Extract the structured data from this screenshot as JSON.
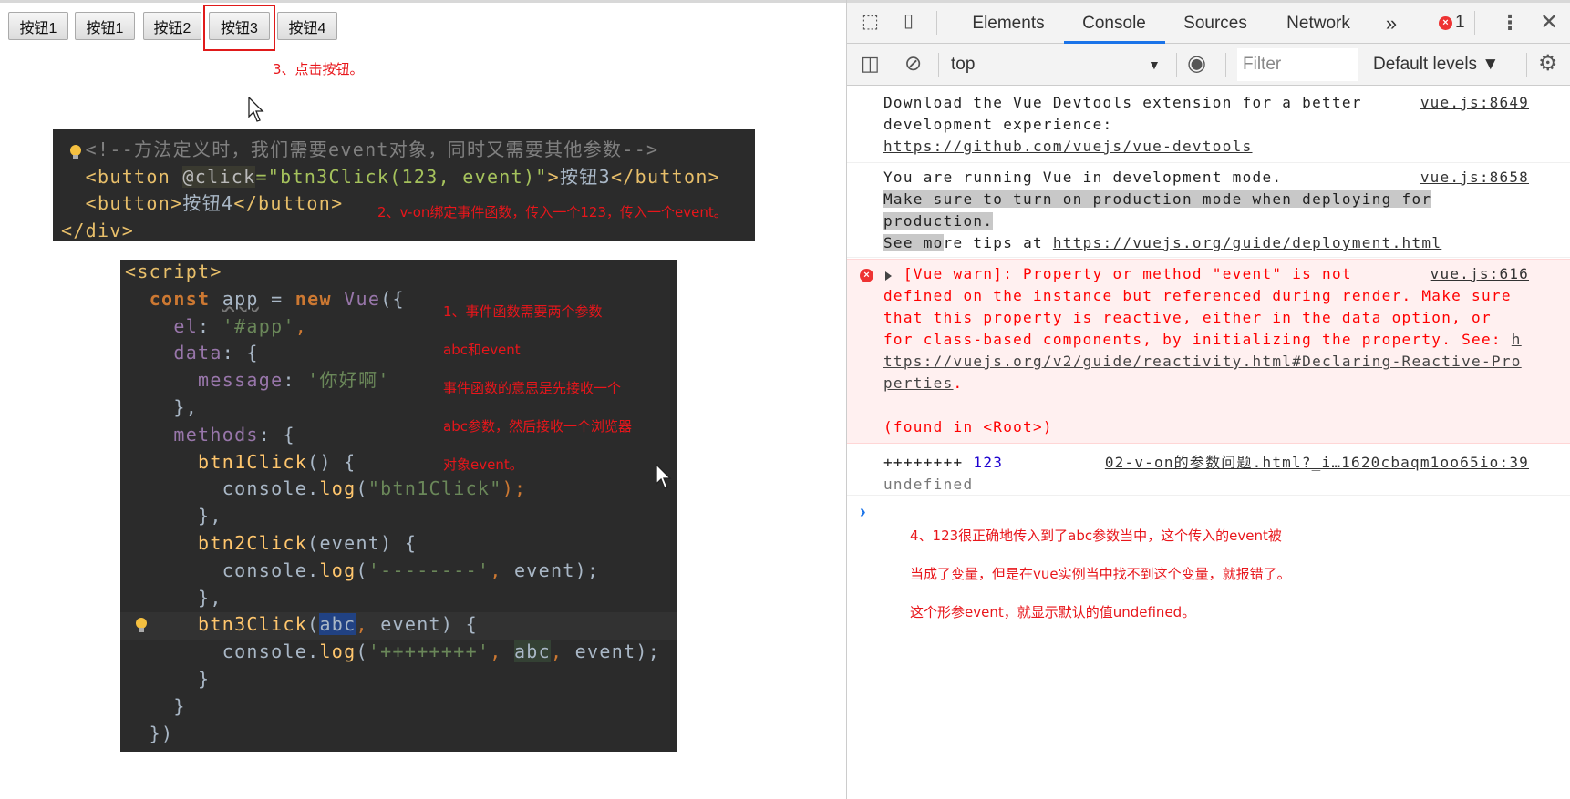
{
  "page": {
    "buttons": [
      "按钮1",
      "按钮1",
      "按钮2",
      "按钮3",
      "按钮4"
    ],
    "annotations": {
      "step3": "3、点击按钮。",
      "step2": "2、v-on绑定事件函数，传入一个123，传入一个event。",
      "step1": [
        "1、事件函数需要两个参数",
        "abc和event",
        "事件函数的意思是先接收一个",
        "abc参数，然后接收一个浏览器",
        "对象event。"
      ],
      "step4": [
        "4、123很正确地传入到了abc参数当中，这个传入的event被",
        "当成了变量，但是在vue实例当中找不到这个变量，就报错了。",
        "这个形参event，就显示默认的值undefined。"
      ]
    }
  },
  "code_html": {
    "lines": [
      [
        {
          "t": "  <!--方法定义时，我们需要event对象，同时又需要其他参数-->",
          "k": "com"
        }
      ],
      [
        {
          "t": "  <button ",
          "k": "tag"
        },
        {
          "t": "@click",
          "k": "attr"
        },
        {
          "t": "=\"btn3Click(123, event)\"",
          "k": "str"
        },
        {
          "t": ">",
          "k": "tag"
        },
        {
          "t": "按钮3",
          "k": "text"
        },
        {
          "t": "</button>",
          "k": "tag"
        }
      ],
      [
        {
          "t": "  <button>",
          "k": "tag"
        },
        {
          "t": "按钮4",
          "k": "text"
        },
        {
          "t": "</button>",
          "k": "tag"
        }
      ],
      [
        {
          "t": "</div>",
          "k": "tag"
        }
      ]
    ]
  },
  "code_script": {
    "lines": [
      [
        {
          "t": "<script>",
          "k": "tag"
        }
      ],
      [
        {
          "t": "  ",
          "k": "text"
        },
        {
          "t": "const ",
          "k": "kw"
        },
        {
          "t": "app",
          "k": "var"
        },
        {
          "t": " = ",
          "k": "text"
        },
        {
          "t": "new ",
          "k": "kw"
        },
        {
          "t": "Vue",
          "k": "prop"
        },
        {
          "t": "({",
          "k": "text"
        }
      ],
      [
        {
          "t": "    el",
          "k": "prop"
        },
        {
          "t": ": ",
          "k": "text"
        },
        {
          "t": "'#app'",
          "k": "strg"
        },
        {
          "t": ",",
          "k": "punc"
        }
      ],
      [
        {
          "t": "    data",
          "k": "prop"
        },
        {
          "t": ": {",
          "k": "text"
        }
      ],
      [
        {
          "t": "      message",
          "k": "prop"
        },
        {
          "t": ": ",
          "k": "text"
        },
        {
          "t": "'你好啊'",
          "k": "strg"
        }
      ],
      [
        {
          "t": "    },",
          "k": "text"
        }
      ],
      [
        {
          "t": "    methods",
          "k": "prop"
        },
        {
          "t": ": {",
          "k": "text"
        }
      ],
      [
        {
          "t": "      btn1Click",
          "k": "fn"
        },
        {
          "t": "() {",
          "k": "text"
        }
      ],
      [
        {
          "t": "        console.",
          "k": "text"
        },
        {
          "t": "log",
          "k": "call"
        },
        {
          "t": "(",
          "k": "text"
        },
        {
          "t": "\"btn1Click\"",
          "k": "strg"
        },
        {
          "t": ");",
          "k": "punc"
        }
      ],
      [
        {
          "t": "      },",
          "k": "text"
        }
      ],
      [
        {
          "t": "      btn2Click",
          "k": "fn"
        },
        {
          "t": "(event) {",
          "k": "text"
        }
      ],
      [
        {
          "t": "        console.",
          "k": "text"
        },
        {
          "t": "log",
          "k": "call"
        },
        {
          "t": "(",
          "k": "text"
        },
        {
          "t": "'--------'",
          "k": "strg"
        },
        {
          "t": ", ",
          "k": "punc"
        },
        {
          "t": "event);",
          "k": "text"
        }
      ],
      [
        {
          "t": "      },",
          "k": "text"
        }
      ],
      [
        {
          "t": "      btn3Click",
          "k": "fn"
        },
        {
          "t": "(",
          "k": "text"
        },
        {
          "t": "abc",
          "k": "sel"
        },
        {
          "t": ", ",
          "k": "punc"
        },
        {
          "t": "event) {",
          "k": "text"
        }
      ],
      [
        {
          "t": "        console.",
          "k": "text"
        },
        {
          "t": "log",
          "k": "call"
        },
        {
          "t": "(",
          "k": "text"
        },
        {
          "t": "'++++++++'",
          "k": "strg"
        },
        {
          "t": ", ",
          "k": "punc"
        },
        {
          "t": "abc",
          "k": "ref"
        },
        {
          "t": ", ",
          "k": "punc"
        },
        {
          "t": "event);",
          "k": "text"
        }
      ],
      [
        {
          "t": "      }",
          "k": "text"
        }
      ],
      [
        {
          "t": "    }",
          "k": "text"
        }
      ],
      [
        {
          "t": "  })",
          "k": "text"
        }
      ]
    ]
  },
  "devtools": {
    "tabs": [
      "Elements",
      "Console",
      "Sources",
      "Network"
    ],
    "active_tab": "Console",
    "more_tabs": "»",
    "error_count": "1",
    "context": "top",
    "filter_placeholder": "Filter",
    "levels": "Default levels ▼",
    "accent": "#1a73e8",
    "messages": [
      {
        "type": "log",
        "source": "vue.js:8649",
        "lines": [
          [
            {
              "t": "Download the Vue Devtools extension for a better",
              "k": "text"
            }
          ],
          [
            {
              "t": "development experience:",
              "k": "text"
            }
          ],
          [
            {
              "t": "https://github.com/vuejs/vue-devtools",
              "k": "link"
            }
          ]
        ]
      },
      {
        "type": "log",
        "source": "vue.js:8658",
        "lines": [
          [
            {
              "t": "You are running Vue in development mode.",
              "k": "text"
            }
          ],
          [
            {
              "t": "Make sure to turn on production mode when deploying for",
              "k": "sel"
            }
          ],
          [
            {
              "t": "production.",
              "k": "sel"
            }
          ],
          [
            {
              "t": "See mo",
              "k": "sel"
            },
            {
              "t": "re tips at ",
              "k": "text"
            },
            {
              "t": "https://vuejs.org/guide/deployment.html",
              "k": "link"
            }
          ]
        ]
      },
      {
        "type": "error",
        "source": "vue.js:616",
        "lines": [
          [
            {
              "t": "  [Vue warn]: Property or method \"event\" is not",
              "k": "text"
            }
          ],
          [
            {
              "t": "defined on the instance but referenced during render. Make sure",
              "k": "text"
            }
          ],
          [
            {
              "t": "that this property is reactive, either in the data option, or",
              "k": "text"
            }
          ],
          [
            {
              "t": "for class-based components, by initializing the property. See: ",
              "k": "text"
            },
            {
              "t": "h",
              "k": "link"
            }
          ],
          [
            {
              "t": "ttps://vuejs.org/v2/guide/reactivity.html#Declaring-Reactive-Pro",
              "k": "link"
            }
          ],
          [
            {
              "t": "perties",
              "k": "link"
            },
            {
              "t": ".",
              "k": "text"
            }
          ],
          [
            {
              "t": "",
              "k": "text"
            }
          ],
          [
            {
              "t": "(found in <Root>)",
              "k": "text"
            }
          ]
        ]
      },
      {
        "type": "log",
        "source": "02-v-on的参数问题.html?_i…1620cbaqm1oo65io:39",
        "lines": [
          [
            {
              "t": "++++++++ ",
              "k": "text"
            },
            {
              "t": "123",
              "k": "num"
            }
          ],
          [
            {
              "t": "undefined",
              "k": "und"
            }
          ]
        ]
      }
    ]
  }
}
